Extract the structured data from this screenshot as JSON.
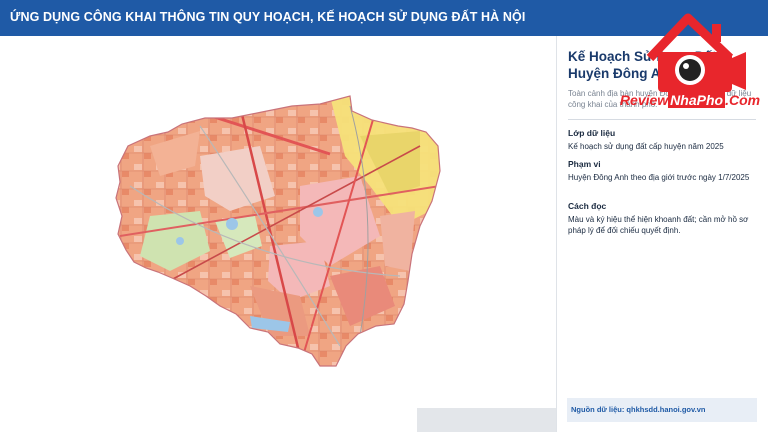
{
  "header": {
    "title": "ỨNG DỤNG CÔNG KHAI THÔNG TIN QUY HOẠCH, KẾ HOẠCH SỬ DỤNG ĐẤT HÀ NỘI"
  },
  "panel": {
    "title_line1": "Kế Hoạch Sử Dụng Đất",
    "title_line2": "Huyện Đông Anh",
    "subtitle": "Toàn cảnh địa bàn huyện Đông Anh trên lớp dữ liệu công khai của thành phố.",
    "sections": [
      {
        "label": "Lớp dữ liệu",
        "value": "Kế hoạch sử dụng đất cấp huyện năm 2025"
      },
      {
        "label": "Phạm vi",
        "value": "Huyện Đông Anh theo địa giới trước ngày 1/7/2025"
      },
      {
        "label": "Cách đọc",
        "value": "Màu và ký hiệu thể hiện khoanh đất; cần mở hồ sơ pháp lý để đối chiếu quyết định."
      }
    ],
    "source": "Nguồn dữ liệu: qhkhsdd.hanoi.gov.vn"
  },
  "logo": {
    "part1": "Review",
    "part2": "NhaPho",
    "part3": ".Com",
    "icon": "house-camera-icon"
  },
  "colors": {
    "header": "#1f5aa6",
    "land_residential": "#f2a07b",
    "land_pink": "#f4b8b8",
    "land_yellow": "#f5e27a",
    "land_green": "#cfe3b0",
    "land_red": "#e25555",
    "logo_red": "#e8262c"
  }
}
